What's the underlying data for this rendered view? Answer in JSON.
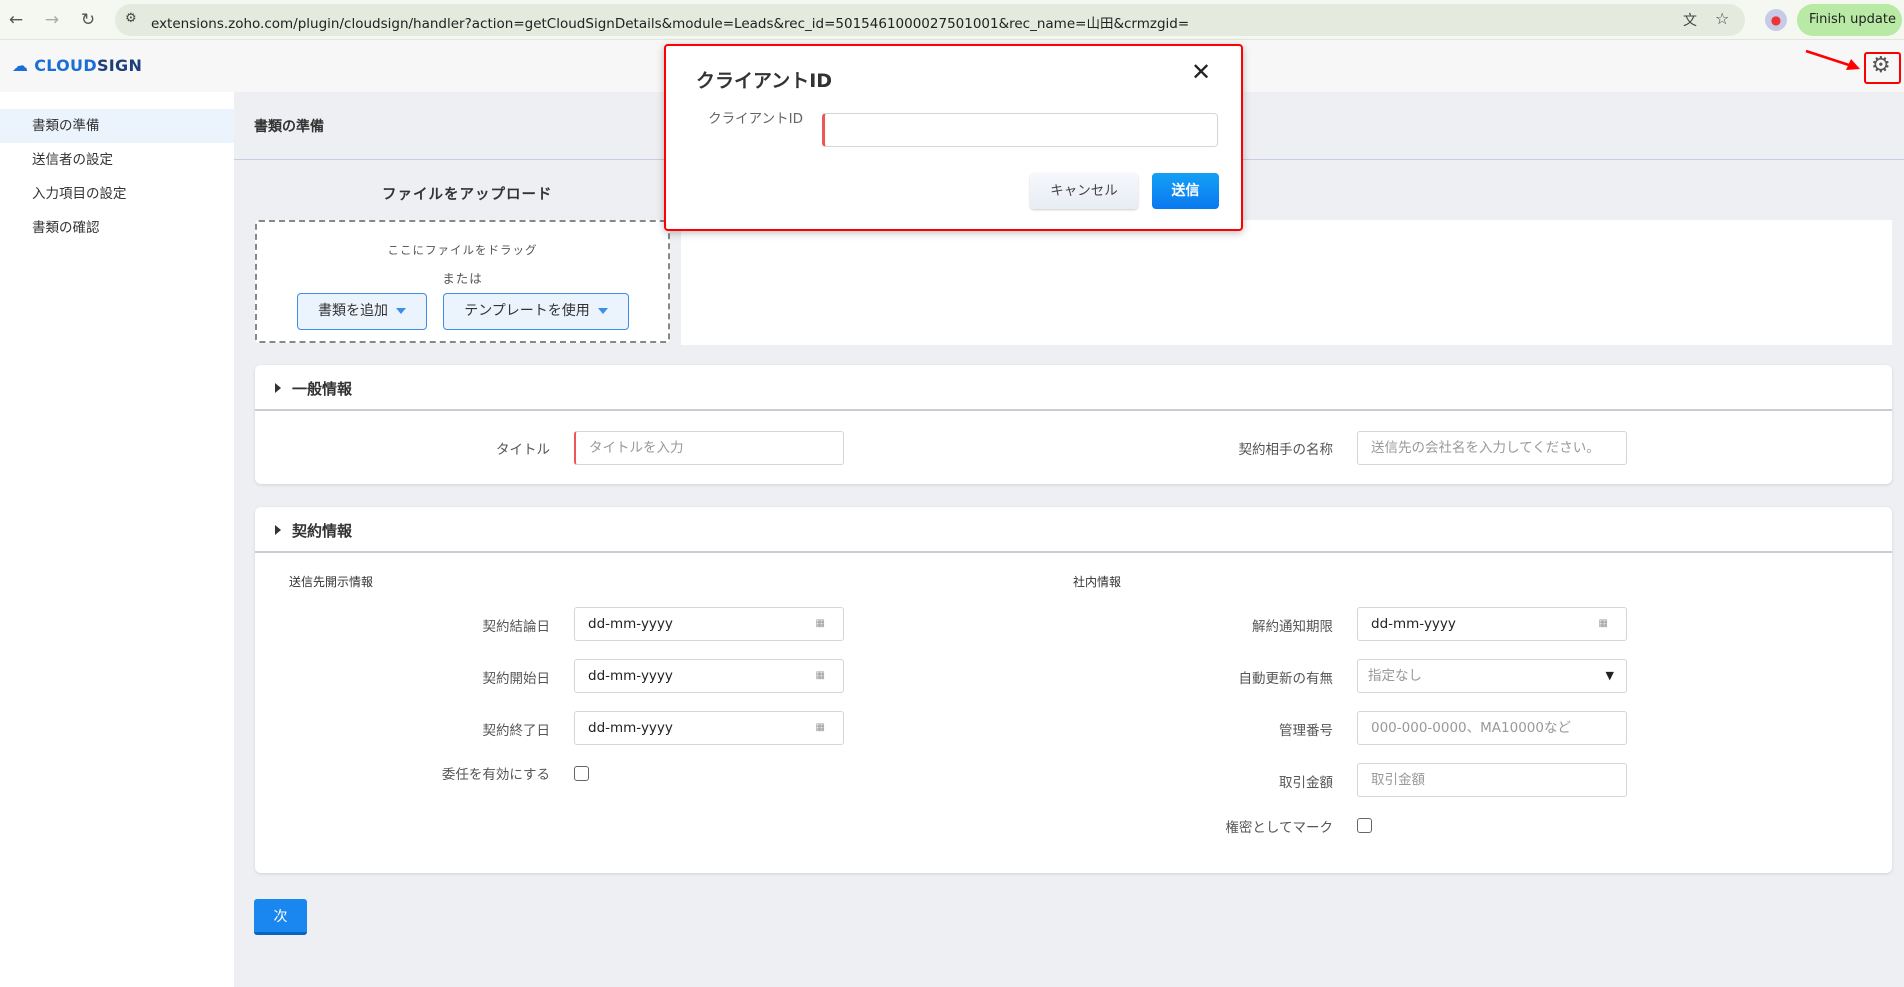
{
  "browser": {
    "url": "extensions.zoho.com/plugin/cloudsign/handler?action=getCloudSignDetails&module=Leads&rec_id=5015461000027501001&rec_name=山田&crmzgid=",
    "finish_update": "Finish update"
  },
  "app": {
    "logo_a": "CLOUD",
    "logo_b": "SIGN"
  },
  "sidebar": {
    "items": [
      {
        "label": "書類の準備"
      },
      {
        "label": "送信者の設定"
      },
      {
        "label": "入力項目の設定"
      },
      {
        "label": "書類の確認"
      }
    ]
  },
  "main": {
    "title": "書類の準備",
    "upload_heading": "ファイルをアップロード",
    "drag_text": "ここにファイルをドラッグ",
    "or_text": "または",
    "add_doc": "書類を追加",
    "use_template": "テンプレートを使用",
    "next": "次"
  },
  "general": {
    "title": "一般情報",
    "title_label": "タイトル",
    "title_placeholder": "タイトルを入力",
    "partner_label": "契約相手の名称",
    "partner_placeholder": "送信先の会社名を入力してください。"
  },
  "contract": {
    "title": "契約情報",
    "left_sub": "送信先開示情報",
    "right_sub": "社内情報",
    "concluded_label": "契約結論日",
    "start_label": "契約開始日",
    "end_label": "契約終了日",
    "delegate_label": "委任を有効にする",
    "date_value": "dd-mm-yyyy",
    "notice_label": "解約通知期限",
    "renew_label": "自動更新の有無",
    "renew_value": "指定なし",
    "mgmt_label": "管理番号",
    "mgmt_placeholder": "000-000-0000、MA10000など",
    "amount_label": "取引金額",
    "amount_placeholder": "取引金額",
    "confidential_label": "権密としてマーク"
  },
  "modal": {
    "title": "クライアントID",
    "field_label": "クライアントID",
    "field_value": "",
    "cancel": "キャンセル",
    "submit": "送信"
  },
  "colors": {
    "accent": "#1a87f0",
    "highlight": "#ff0000"
  }
}
